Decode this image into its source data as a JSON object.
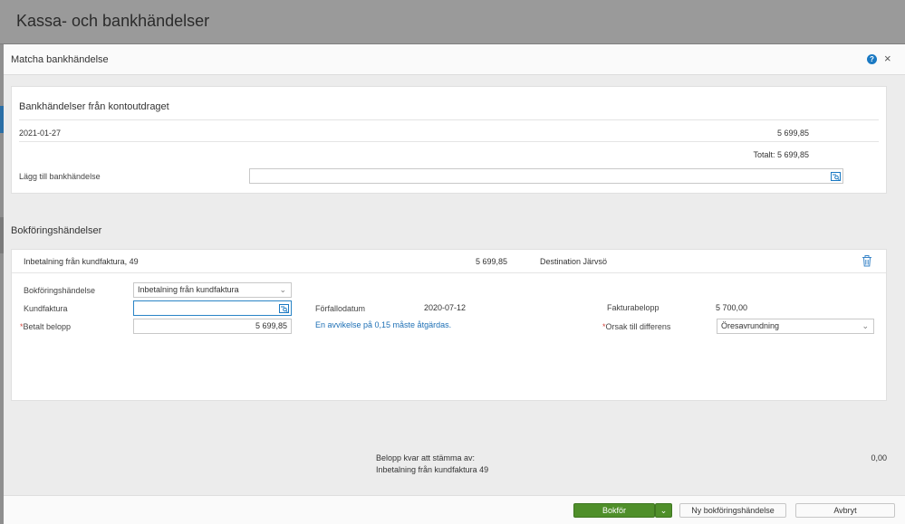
{
  "background": {
    "page_title": "Kassa- och bankhändelser"
  },
  "dialog": {
    "title": "Matcha bankhändelse",
    "help_label": "?",
    "close_label": "×"
  },
  "bank_section": {
    "title": "Bankhändelser från kontoutdraget",
    "row": {
      "date": "2021-01-27",
      "amount": "5 699,85"
    },
    "total": "Totalt: 5 699,85",
    "add_label": "Lägg till bankhändelse",
    "add_value": ""
  },
  "booking_section": {
    "title": "Bokföringshändelser",
    "summary": {
      "description": "Inbetalning från kundfaktura, 49",
      "amount": "5 699,85",
      "customer": "Destination Järvsö"
    },
    "form": {
      "event_label": "Bokföringshändelse",
      "event_value": "Inbetalning från kundfaktura",
      "invoice_label": "Kundfaktura",
      "invoice_value": "",
      "paid_label": "Betalt belopp",
      "paid_value": "5 699,85",
      "due_label": "Förfallodatum",
      "due_value": "2020-07-12",
      "deviation_text": "En avvikelse på 0,15 måste åtgärdas.",
      "invoice_amount_label": "Fakturabelopp",
      "invoice_amount_value": "5 700,00",
      "reason_label": "Orsak till differens",
      "reason_value": "Öresavrundning",
      "required_mark": "*"
    }
  },
  "remaining": {
    "label_line1": "Belopp kvar att stämma av:",
    "label_line2": "Inbetalning från kundfaktura 49",
    "value": "0,00"
  },
  "footer": {
    "post_button": "Bokför",
    "new_event_button": "Ny bokföringshändelse",
    "cancel_button": "Avbryt"
  },
  "colors": {
    "primary_button": "#4f8f2a",
    "accent": "#1a79c3",
    "required": "#d3473f",
    "link": "#1d6fb5"
  }
}
